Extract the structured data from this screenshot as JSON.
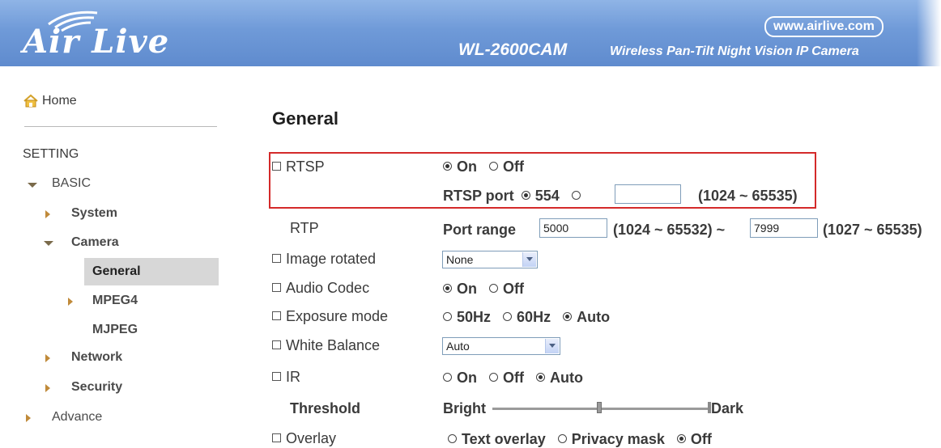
{
  "header": {
    "logo_text": "Air Live",
    "site_url": "www.airlive.com",
    "model": "WL-2600CAM",
    "model_description": "Wireless Pan-Tilt Night Vision IP Camera"
  },
  "sidebar": {
    "home": "Home",
    "setting": "SETTING",
    "basic": "BASIC",
    "system": "System",
    "camera": "Camera",
    "general": "General",
    "mpeg4": "MPEG4",
    "mjpeg": "MJPEG",
    "network": "Network",
    "security": "Security",
    "advance": "Advance"
  },
  "main": {
    "title": "General",
    "rtsp": {
      "label": "RTSP",
      "on": "On",
      "off": "Off",
      "selected": "On",
      "port_label": "RTSP port",
      "port_default": "554",
      "port_custom_value": "",
      "port_range": "(1024 ~ 65535)"
    },
    "rtp": {
      "label": "RTP",
      "port_range_label": "Port range",
      "start_value": "5000",
      "start_range": "(1024 ~ 65532) ~",
      "end_value": "7999",
      "end_range": "(1027 ~ 65535)"
    },
    "image_rotated": {
      "label": "Image rotated",
      "selected": "None"
    },
    "audio_codec": {
      "label": "Audio Codec",
      "on": "On",
      "off": "Off",
      "selected": "On"
    },
    "exposure_mode": {
      "label": "Exposure mode",
      "opt1": "50Hz",
      "opt2": "60Hz",
      "opt3": "Auto",
      "selected": "Auto"
    },
    "white_balance": {
      "label": "White Balance",
      "selected": "Auto"
    },
    "ir": {
      "label": "IR",
      "on": "On",
      "off": "Off",
      "auto": "Auto",
      "selected": "Auto"
    },
    "threshold": {
      "label": "Threshold",
      "left": "Bright",
      "right": "Dark",
      "level": 0.5
    },
    "overlay": {
      "label": "Overlay",
      "opt1": "Text overlay",
      "opt2": "Privacy mask",
      "opt3": "Off",
      "selected": "Off"
    }
  },
  "colors": {
    "header_blue": "#6f9ad8",
    "highlight_red": "#d42a2a",
    "nav_selected_bg": "#d7d7d7"
  }
}
